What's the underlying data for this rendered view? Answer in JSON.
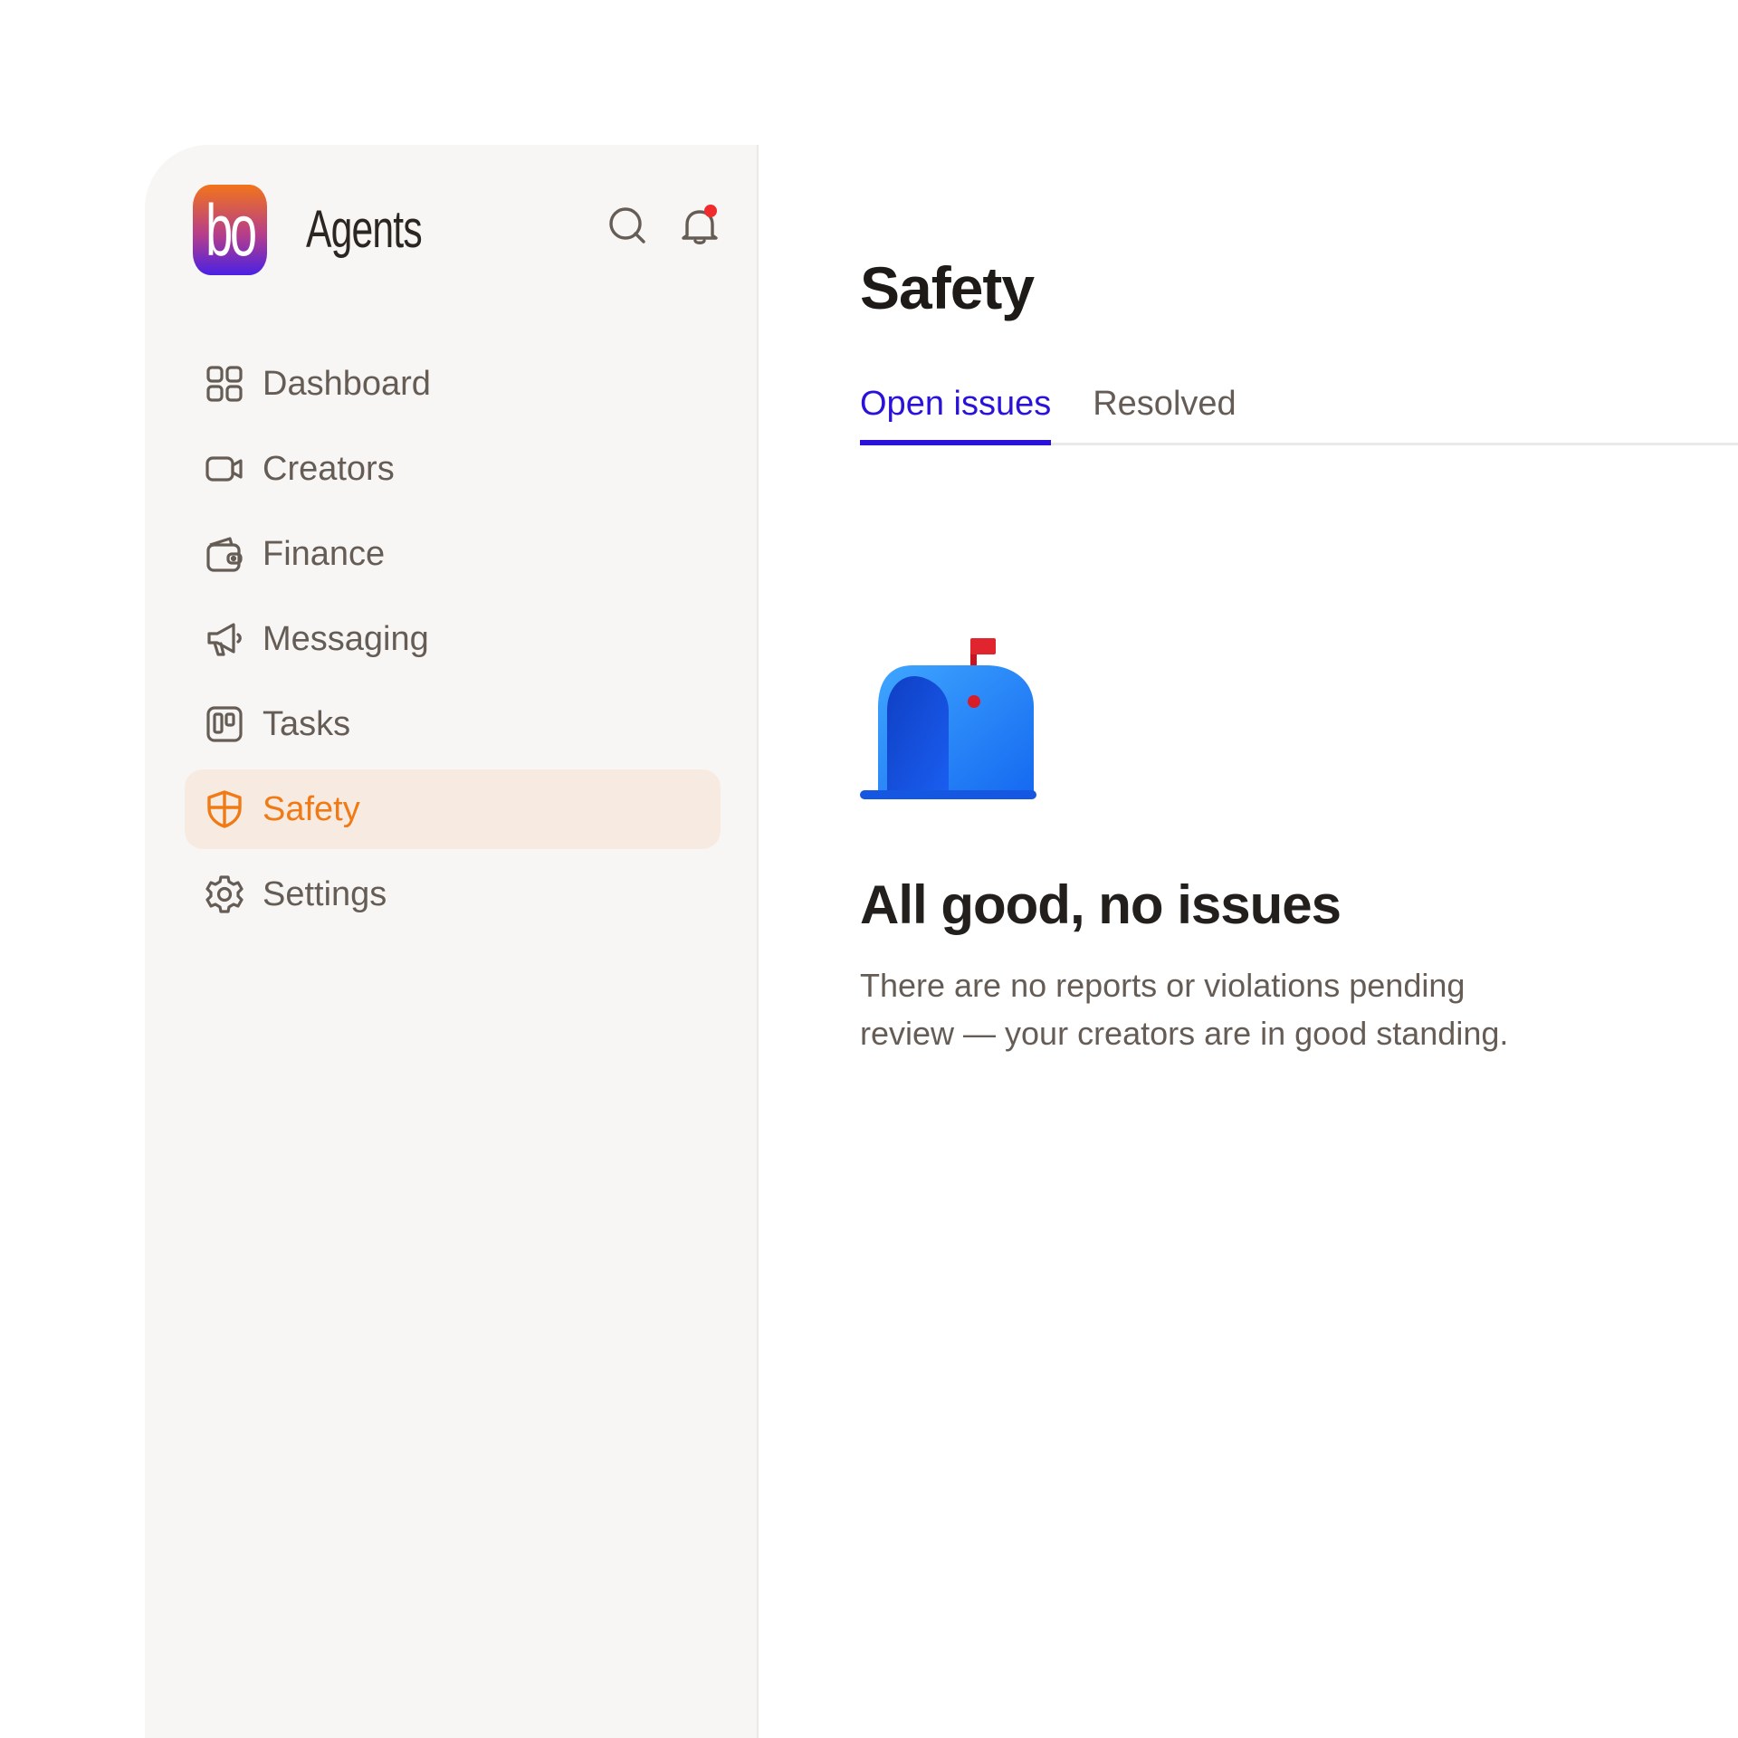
{
  "app": {
    "logo_text": "bo",
    "name": "Agents"
  },
  "header_icons": [
    "search-icon",
    "bell-icon"
  ],
  "sidebar": {
    "items": [
      {
        "label": "Dashboard",
        "icon": "grid-icon",
        "active": false
      },
      {
        "label": "Creators",
        "icon": "video-icon",
        "active": false
      },
      {
        "label": "Finance",
        "icon": "wallet-icon",
        "active": false
      },
      {
        "label": "Messaging",
        "icon": "megaphone-icon",
        "active": false
      },
      {
        "label": "Tasks",
        "icon": "kanban-icon",
        "active": false
      },
      {
        "label": "Safety",
        "icon": "shield-icon",
        "active": true
      },
      {
        "label": "Settings",
        "icon": "gear-icon",
        "active": false
      }
    ]
  },
  "main": {
    "title": "Safety",
    "tabs": [
      {
        "label": "Open issues",
        "active": true
      },
      {
        "label": "Resolved",
        "active": false
      }
    ],
    "empty_state": {
      "illustration": "mailbox-icon",
      "title": "All good, no issues",
      "description": "There are no reports or violations pending review — your creators are in good standing."
    }
  },
  "colors": {
    "accent": "#ef7a16",
    "active_bg": "#f7ebe1",
    "tab_accent": "#2a12d8",
    "notification_dot": "#ef2b2b",
    "sidebar_bg": "#f7f6f4"
  }
}
